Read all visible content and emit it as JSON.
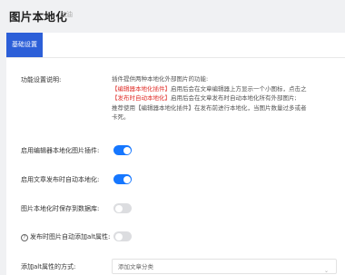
{
  "header": {
    "title": "图片本地化",
    "subtitle": "加油"
  },
  "tabs": [
    {
      "label": "基础设置",
      "active": true
    }
  ],
  "colors": {
    "accent": "#2c5fd8",
    "toggle_on": "#1677ff",
    "highlight": "#e0302b"
  },
  "settings": {
    "description": {
      "label": "功能设置说明:",
      "line1": "插件提供两种本地化外部图片的功能:",
      "line2_hl": "【编辑器本地化插件】",
      "line2_rest": "启用后会在文章编辑器上方显示一个小图标，点击之",
      "line3_hl": "【发布时自动本地化】",
      "line3_rest": "启用后会在文章发布时自动本地化所有外部图片;",
      "line4": "推荐使用【编辑器本地化插件】在发布前进行本地化，当图片数量过多或者",
      "line5": "卡死。"
    },
    "toggles": [
      {
        "label": "启用编辑器本地化图片插件:",
        "on": true
      },
      {
        "label": "启用文章发布时自动本地化:",
        "on": true
      },
      {
        "label": "图片本地化时保存到数据库:",
        "on": false
      },
      {
        "label": "发布时图片自动添加alt属性:",
        "on": false,
        "help_icon": "question-circle-icon",
        "help_glyph": "?"
      }
    ],
    "alt_method": {
      "label": "添加alt属性的方式:",
      "value": "添加文章分类",
      "caret_icon": "chevron-down-icon",
      "caret_glyph": "⌄"
    }
  }
}
